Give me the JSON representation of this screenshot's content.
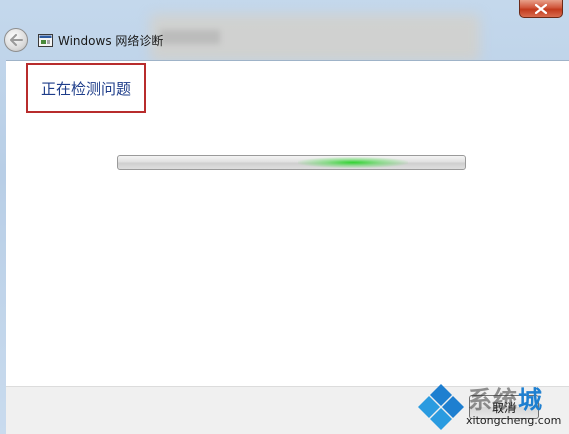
{
  "window": {
    "title": "Windows 网络诊断"
  },
  "content": {
    "heading": "正在检测问题",
    "progress": {
      "state": "indeterminate",
      "glow_color": "#2ecc40"
    }
  },
  "footer": {
    "cancel_label": "取消"
  },
  "watermark": {
    "cn_part1": "系统",
    "cn_part2": "城",
    "domain": "xitongcheng.com"
  },
  "colors": {
    "heading": "#1e3d8a",
    "highlight_box": "#b82c2c",
    "close_button": "#c23a1d",
    "watermark_blue": "#1e7fd0"
  },
  "icons": {
    "close": "close-icon",
    "back": "back-arrow-icon",
    "app": "network-diagnostics-icon",
    "watermark_logo": "diamond-logo-icon"
  }
}
